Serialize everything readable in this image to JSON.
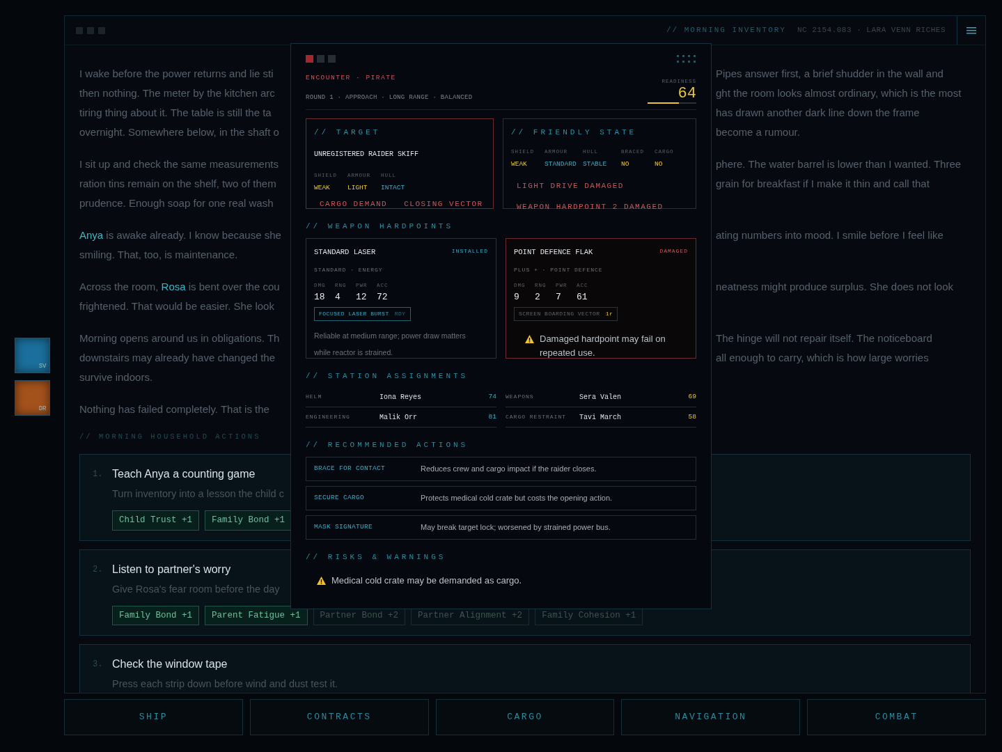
{
  "header": {
    "title": "// MORNING INVENTORY",
    "meta": "NC 2154.083 · LARA VENN RICHES"
  },
  "rail": [
    {
      "label": "SV",
      "color": "#1b6f9c"
    },
    {
      "label": "DR",
      "color": "#a4521c"
    }
  ],
  "story": [
    {
      "lines": [
        {
          "left": "I wake before the power returns and lie sti",
          "right": "Pipes answer first, a brief shudder in the wall and"
        },
        {
          "left": "then nothing. The meter by the kitchen arc",
          "right": "ght the room looks almost ordinary, which is the most"
        },
        {
          "left": "tiring thing about it. The table is still the ta",
          "right": "has drawn another dark line down the frame"
        },
        {
          "left": "overnight. Somewhere below, in the shaft o",
          "right": "become a rumour."
        }
      ]
    },
    {
      "lines": [
        {
          "left": "I sit up and check the same measurements",
          "right": "phere. The water barrel is lower than I wanted. Three"
        },
        {
          "left": "ration tins remain on the shelf, two of them",
          "right": "grain for breakfast if I make it thin and call that"
        },
        {
          "left": "prudence. Enough soap for one real wash"
        }
      ]
    },
    {
      "lines": [
        {
          "left": "**Anya** is awake already. I know because she",
          "right": "ating numbers into mood. I smile before I feel like"
        },
        {
          "left": "smiling. That, too, is maintenance."
        }
      ]
    },
    {
      "lines": [
        {
          "left": "Across the room, **Rosa** is bent over the cou",
          "right": "neatness might produce surplus. She does not look"
        },
        {
          "left": "frightened. That would be easier. She look"
        }
      ]
    },
    {
      "lines": [
        {
          "left": "Morning opens around us in obligations. Th",
          "right": "The hinge will not repair itself. The noticeboard"
        },
        {
          "left": "downstairs may already have changed the",
          "right": "all enough to carry, which is how large worries"
        },
        {
          "left": "survive indoors."
        }
      ]
    },
    {
      "lines": [
        {
          "left": "Nothing has failed completely. That is the"
        }
      ]
    }
  ],
  "section_title": "// MORNING HOUSEHOLD ACTIONS",
  "household_actions": [
    {
      "number": "1.",
      "title": "Teach Anya a counting game",
      "description": "Turn inventory into a lesson the child c",
      "tags": [
        {
          "label": "Child Trust +1",
          "highlighted": true
        },
        {
          "label": "Family Bond +1",
          "highlighted": true
        }
      ]
    },
    {
      "number": "2.",
      "title": "Listen to partner's worry",
      "description": "Give Rosa's fear room before the day",
      "tags": [
        {
          "label": "Family Bond +1",
          "highlighted": true
        },
        {
          "label": "Parent Fatigue +1",
          "highlighted": true
        },
        {
          "label": "Partner Bond +2",
          "highlighted": false
        },
        {
          "label": "Partner Alignment +2",
          "highlighted": false
        },
        {
          "label": "Family Cohesion +1",
          "highlighted": false
        }
      ]
    },
    {
      "number": "3.",
      "title": "Check the window tape",
      "description": "Press each strip down before wind and dust test it."
    }
  ],
  "nav": [
    {
      "label": "SHIP"
    },
    {
      "label": "CONTRACTS"
    },
    {
      "label": "CARGO"
    },
    {
      "label": "NAVIGATION"
    },
    {
      "label": "COMBAT"
    }
  ],
  "encounter": {
    "kicker": "ENCOUNTER · PIRATE",
    "subtitle": "ROUND 1 · APPROACH · LONG RANGE · BALANCED",
    "readiness": {
      "label": "READINESS",
      "value": "64",
      "level": 0.64
    },
    "target": {
      "heading": "// TARGET",
      "name": "UNREGISTERED RAIDER SKIFF",
      "stats": [
        {
          "label": "SHIELD",
          "value": "WEAK",
          "warn": true
        },
        {
          "label": "ARMOUR",
          "value": "LIGHT",
          "warn": true
        },
        {
          "label": "HULL",
          "value": "INTACT",
          "warn": false
        }
      ],
      "flags": [
        "CARGO DEMAND",
        "CLOSING VECTOR"
      ]
    },
    "friendly": {
      "heading": "// FRIENDLY STATE",
      "stats": [
        {
          "label": "SHIELD",
          "value": "WEAK",
          "warn": true
        },
        {
          "label": "ARMOUR",
          "value": "STANDARD",
          "warn": false
        },
        {
          "label": "HULL",
          "value": "STABLE",
          "warn": false
        },
        {
          "label": "BRACED",
          "value": "NO",
          "warn": true
        },
        {
          "label": "CARGO",
          "value": "NO",
          "warn": true
        }
      ],
      "alerts": [
        "LIGHT DRIVE DAMAGED",
        "WEAPON HARDPOINT 2 DAMAGED"
      ]
    },
    "weapons": {
      "heading": "// WEAPON HARDPOINTS",
      "items": [
        {
          "kind": "installed",
          "name": "STANDARD LASER",
          "status": "INSTALLED",
          "subtitle": "STANDARD · ENERGY",
          "stats": [
            {
              "label": "DMG",
              "value": "18"
            },
            {
              "label": "RNG",
              "value": "4"
            },
            {
              "label": "PWR",
              "value": "12"
            },
            {
              "label": "ACC",
              "value": "72"
            }
          ],
          "ability": {
            "name": "FOCUSED LASER BURST",
            "state": "RDY",
            "ready": true
          },
          "note": "Reliable at medium range; power draw matters while reactor is strained."
        },
        {
          "kind": "damaged",
          "name": "POINT DEFENCE FLAK",
          "status": "DAMAGED",
          "subtitle": "PLUS + · POINT DEFENCE",
          "stats": [
            {
              "label": "DMG",
              "value": "9"
            },
            {
              "label": "RNG",
              "value": "2"
            },
            {
              "label": "PWR",
              "value": "7"
            },
            {
              "label": "ACC",
              "value": "61"
            }
          ],
          "ability": {
            "name": "SCREEN BOARDING VECTOR",
            "state": "1r",
            "ready": false
          },
          "warning": "Damaged hardpoint may fail on repeated use."
        }
      ]
    },
    "stations": {
      "heading": "// STATION ASSIGNMENTS",
      "rows": [
        {
          "role": "HELM",
          "name": "Iona Reyes",
          "score": "74",
          "warn": false
        },
        {
          "role": "WEAPONS",
          "name": "Sera Valen",
          "score": "69",
          "warn": true
        },
        {
          "role": "ENGINEERING",
          "name": "Malik Orr",
          "score": "81",
          "warn": false
        },
        {
          "role": "CARGO RESTRAINT",
          "name": "Tavi March",
          "score": "58",
          "warn": true
        }
      ]
    },
    "actions": {
      "heading": "// RECOMMENDED ACTIONS",
      "items": [
        {
          "name": "BRACE FOR CONTACT",
          "description": "Reduces crew and cargo impact if the raider closes."
        },
        {
          "name": "SECURE CARGO",
          "description": "Protects medical cold crate but costs the opening action."
        },
        {
          "name": "MASK SIGNATURE",
          "description": "May break target lock; worsened by strained power bus."
        }
      ]
    },
    "risks": {
      "heading": "// RISKS & WARNINGS",
      "items": [
        "Medical cold crate may be demanded as cargo."
      ]
    }
  }
}
